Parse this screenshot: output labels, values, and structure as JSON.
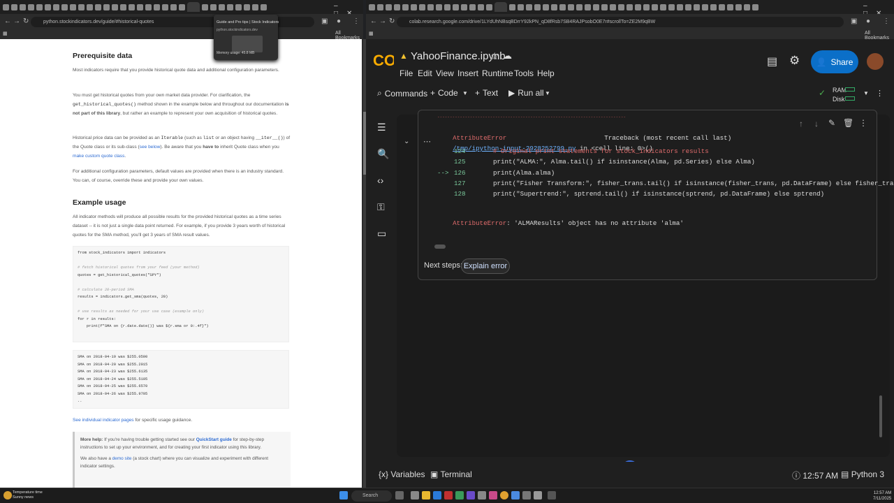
{
  "left_browser": {
    "url": "python.stockindicators.dev/guide/#historical-quotes",
    "bookmarks_label": "All Bookmarks",
    "tab_preview": {
      "title": "Guide and Pro tips | Stock Indicators",
      "url": "python.stockindicators.dev",
      "memory": "Memory usage: 45.8 MB"
    }
  },
  "doc": {
    "h_prereq": "Prerequisite data",
    "p1": "Most indicators require that you provide historical quote data and additional configuration parameters.",
    "p2a": "You must get historical quotes from your own market data provider. For clarification, the",
    "p2code": "get_historical_quotes()",
    "p2b": "method shown in the example below and throughout our documentation",
    "p2bold": "is not part of this library",
    "p2c": ", but rather an example to represent your own acquisition of historical quotes.",
    "p3a": "Historical price data can be provided as an",
    "p3code1": "Iterable",
    "p3b": "(such as",
    "p3code2": "list",
    "p3c": "or an object having",
    "p3code3": "__iter__()",
    "p3d": ") of the Quote class or its sub-class (",
    "p3link1": "see below",
    "p3e": "). Be aware that you",
    "p3bold": "have to",
    "p3f": "inherit Quote class when you",
    "p3link2": "make custom quote class",
    "p3g": ".",
    "p4": "For additional configuration parameters, default values are provided when there is an industry standard. You can, of course, override these and provide your own values.",
    "h_example": "Example usage",
    "p5": "All indicator methods will produce all possible results for the provided historical quotes as a time series dataset -- it is not just a single data point returned. For example, if you provide 3 years worth of historical quotes for the SMA method, you'll get 3 years of SMA result values.",
    "code1": [
      {
        "t": "from stock_indicators import indicators",
        "c": ""
      },
      {
        "t": "",
        "c": ""
      },
      {
        "t": "# fetch historical quotes from your feed (your method)",
        "c": "cm"
      },
      {
        "t": "quotes = get_historical_quotes(\"SPY\")",
        "c": ""
      },
      {
        "t": "",
        "c": ""
      },
      {
        "t": "# calculate 20-period SMA",
        "c": "cm"
      },
      {
        "t": "results = indicators.get_sma(quotes, 20)",
        "c": ""
      },
      {
        "t": "",
        "c": ""
      },
      {
        "t": "# use results as needed for your use case (example only)",
        "c": "cm"
      },
      {
        "t": "for r in results:",
        "c": ""
      },
      {
        "t": "    print(f\"SMA on {r.date.date()} was ${r.sma or 0:.4f}\")",
        "c": ""
      }
    ],
    "code2": [
      "SMA on 2018-04-19 was $255.0590",
      "SMA on 2018-04-20 was $255.2015",
      "SMA on 2018-04-23 was $255.6135",
      "SMA on 2018-04-24 was $255.5105",
      "SMA on 2018-04-25 was $255.6570",
      "SMA on 2018-04-26 was $255.9705",
      ".."
    ],
    "p6link": "See individual indicator pages",
    "p6": "for specific usage guidance.",
    "note_bold": "More help:",
    "note1a": "If you're having trouble getting started see our",
    "note1link": "QuickStart guide",
    "note1b": "for step-by-step instructions to set up your environment, and for creating your first indicator using this library.",
    "note2a": "We also have a",
    "note2link": "demo site",
    "note2b": "(a stock chart) where you can visualize and experiment with different indicator settings."
  },
  "right_browser": {
    "url": "colab.research.google.com/drive/1LYdUhNBsqBDrrY92kPN_qD8fRsb7SB4RAJPsobO0E7r#scrollTo=ZE2M9qBW",
    "bookmarks_label": "All Bookmarks"
  },
  "colab": {
    "logo": "CO",
    "title": "YahooFinance.ipynb",
    "menu": [
      "File",
      "Edit",
      "View",
      "Insert",
      "Runtime",
      "Tools",
      "Help"
    ],
    "toolbar": {
      "commands": "Commands",
      "code": "Code",
      "text": "Text",
      "run_all": "Run all"
    },
    "share": "Share",
    "ram": "RAM",
    "disk": "Disk",
    "output": {
      "dashes": "---------------------------------------------------------------------------",
      "error_type": "AttributeError",
      "traceback": "Traceback (most recent call last)",
      "file_link": "/tmp/ipython-input-2928252799.py",
      "file_in": " in <cell line: 0>()",
      "lines": [
        {
          "no": "124",
          "arrow": "",
          "code": "# Original print statements for stock_indicators results",
          "kind": "comment"
        },
        {
          "no": "125",
          "arrow": "",
          "code": "print(\"ALMA:\", Alma.tail() if isinstance(Alma, pd.Series) else Alma)",
          "kind": "code"
        },
        {
          "no": "126",
          "arrow": "--> ",
          "code": "print(Alma.alma)",
          "kind": "code"
        },
        {
          "no": "127",
          "arrow": "",
          "code": "print(\"Fisher Transform:\", fisher_trans.tail() if isinstance(fisher_trans, pd.DataFrame) else fisher_trans)",
          "kind": "code"
        },
        {
          "no": "128",
          "arrow": "",
          "code": "print(\"Supertrend:\", sptrend.tail() if isinstance(sptrend, pd.DataFrame) else sptrend)",
          "kind": "code"
        }
      ],
      "final_error": "AttributeError",
      "final_msg": ": 'ALMAResults' object has no attribute 'alma'"
    },
    "next_steps": "Next steps:",
    "explain_error": "Explain error",
    "bottom": {
      "variables": "Variables",
      "terminal": "Terminal",
      "time": "12:57 AM",
      "kernel": "Python 3"
    }
  },
  "taskbar": {
    "weather_temp": "Temperature time",
    "weather_sub": "Sunny news",
    "search": "Search",
    "clock_time": "12:57 AM",
    "clock_date": "7/11/2025"
  }
}
